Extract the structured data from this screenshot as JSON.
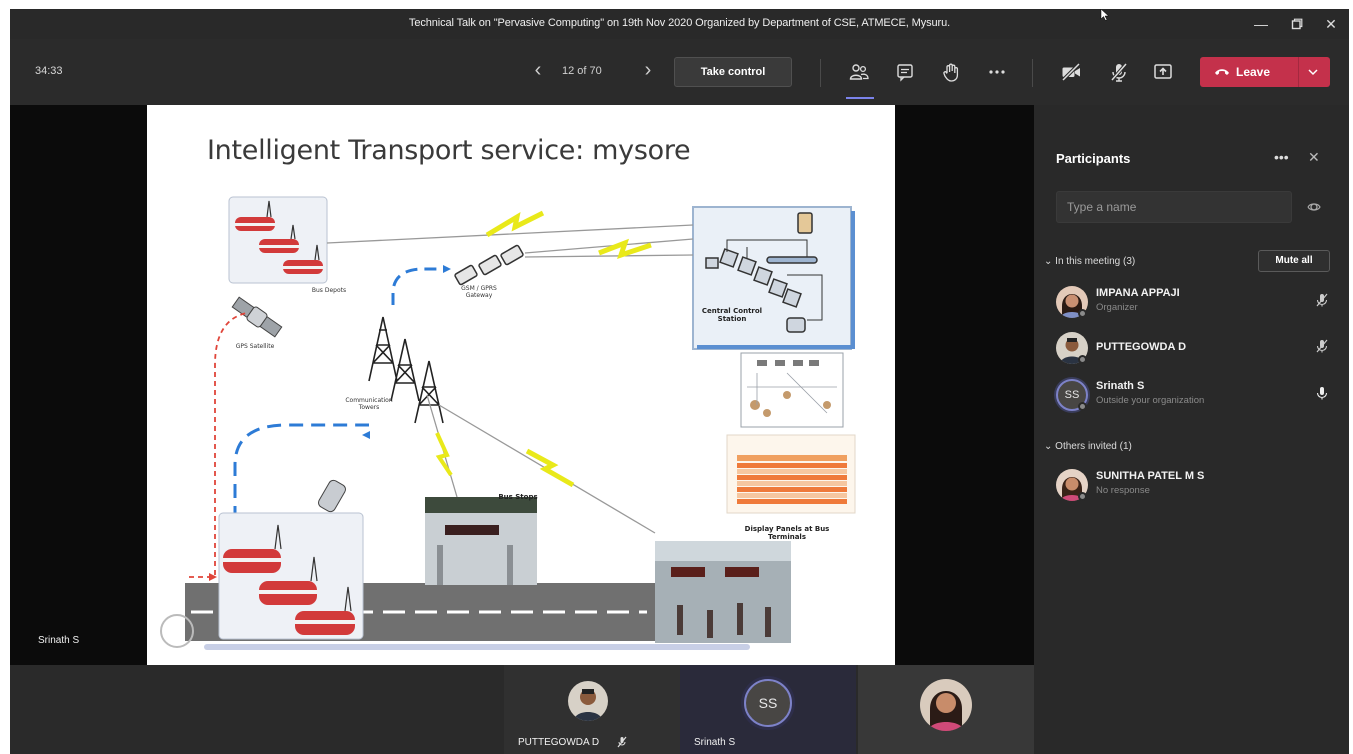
{
  "window": {
    "title": "Technical Talk on \"Pervasive Computing\" on 19th Nov 2020 Organized by Department of CSE, ATMECE, Mysuru."
  },
  "toolbar": {
    "timer": "34:33",
    "page_indicator": "12 of 70",
    "take_control_label": "Take control",
    "leave_label": "Leave"
  },
  "slide": {
    "title": "Intelligent Transport service: mysore",
    "labels": {
      "bus_depots": "Bus Depots",
      "gps_satellite": "GPS Satellite",
      "gateway": "GSM / GPRS Gateway",
      "communication_towers": "Communication Towers",
      "central_control_station": "Central Control Station",
      "bus_stops": "Bus Stops",
      "display_panels": "Display Panels at Bus Terminals"
    }
  },
  "stage": {
    "presenter_name": "Srinath S"
  },
  "bottom_strip": {
    "tiles": [
      {
        "name": "PUTTEGOWDA D"
      },
      {
        "name": "Srinath S",
        "initials": "SS"
      }
    ]
  },
  "panel": {
    "title": "Participants",
    "search_placeholder": "Type a name",
    "in_meeting_label": "In this meeting (3)",
    "mute_all_label": "Mute all",
    "others_invited_label": "Others invited (1)",
    "participants": [
      {
        "name": "IMPANA APPAJI",
        "subtitle": "Organizer"
      },
      {
        "name": "PUTTEGOWDA D",
        "subtitle": ""
      },
      {
        "name": "Srinath S",
        "subtitle": "Outside your organization",
        "initials": "SS"
      }
    ],
    "invited": [
      {
        "name": "SUNITHA PATEL M S",
        "subtitle": "No response"
      }
    ]
  },
  "colors": {
    "leave": "#c4314b",
    "accent": "#7b83eb",
    "panel_bg": "#292929"
  }
}
